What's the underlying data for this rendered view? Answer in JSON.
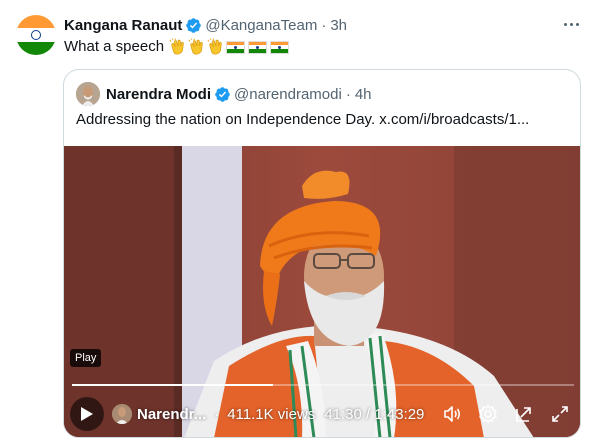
{
  "tweet": {
    "author_name": "Kangana Ranaut",
    "handle": "@KanganaTeam",
    "separator": "·",
    "time": "3h",
    "text": "What a speech",
    "emoji": [
      "clapping-hands",
      "clapping-hands",
      "clapping-hands",
      "india-flag",
      "india-flag",
      "india-flag"
    ]
  },
  "quote": {
    "author_name": "Narendra Modi",
    "handle": "@narendramodi",
    "separator": "·",
    "time": "4h",
    "text": "Addressing the nation on Independence Day. x.com/i/broadcasts/1..."
  },
  "video": {
    "tooltip": "Play",
    "author_short": "Narendr...",
    "views": "411.1K views",
    "time_display": "41:30 / 1:43:29",
    "progress_fraction": 0.4,
    "icons": [
      "play-icon",
      "volume-icon",
      "settings-icon",
      "picture-in-picture-icon",
      "fullscreen-icon"
    ]
  },
  "colors": {
    "verified_blue": "#1d9bf0",
    "muted_text": "#536471",
    "saffron": "#ff9933",
    "india_green": "#138808"
  }
}
